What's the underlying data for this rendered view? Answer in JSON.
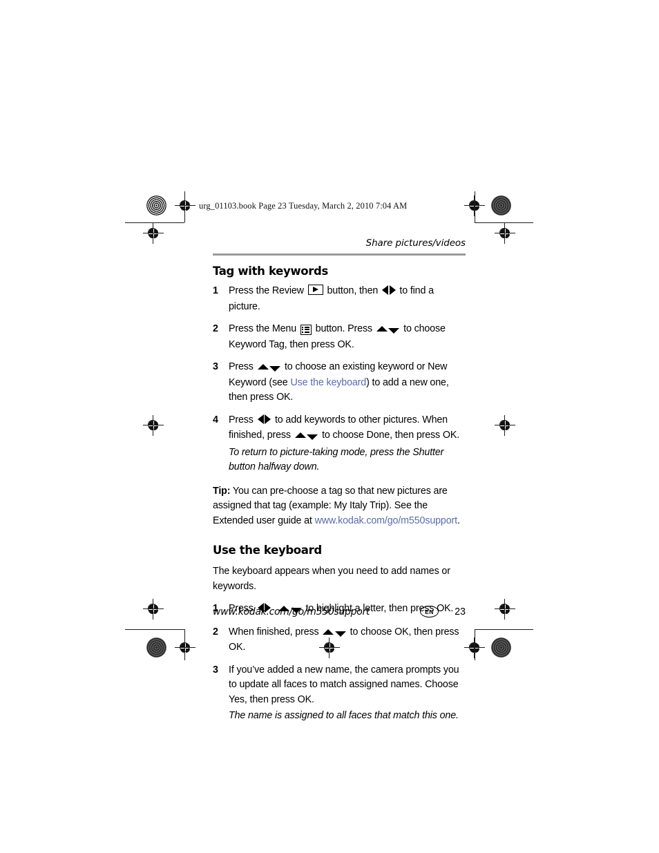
{
  "print_marks": {
    "filename_slug": "urg_01103.book  Page 23  Tuesday, March 2, 2010  7:04 AM"
  },
  "header": {
    "running_head": "Share pictures/videos"
  },
  "sections": [
    {
      "title": "Tag with keywords",
      "steps": [
        {
          "num": "1",
          "parts": [
            {
              "type": "text",
              "value": "Press the Review "
            },
            {
              "type": "icon",
              "value": "review-button-icon"
            },
            {
              "type": "text",
              "value": " button, then "
            },
            {
              "type": "icon",
              "value": "left-right-arrows-icon"
            },
            {
              "type": "text",
              "value": " to find a picture."
            }
          ]
        },
        {
          "num": "2",
          "parts": [
            {
              "type": "text",
              "value": "Press the Menu "
            },
            {
              "type": "icon",
              "value": "menu-button-icon"
            },
            {
              "type": "text",
              "value": " button. Press "
            },
            {
              "type": "icon",
              "value": "up-down-arrows-icon"
            },
            {
              "type": "text",
              "value": " to choose Keyword Tag, then press OK."
            }
          ]
        },
        {
          "num": "3",
          "parts": [
            {
              "type": "text",
              "value": "Press "
            },
            {
              "type": "icon",
              "value": "up-down-arrows-icon"
            },
            {
              "type": "text",
              "value": " to choose an existing keyword or New Keyword (see "
            },
            {
              "type": "link",
              "value": "Use the keyboard"
            },
            {
              "type": "text",
              "value": ") to add a new one, then press OK."
            }
          ]
        },
        {
          "num": "4",
          "parts": [
            {
              "type": "text",
              "value": "Press "
            },
            {
              "type": "icon",
              "value": "left-right-arrows-icon"
            },
            {
              "type": "text",
              "value": " to add keywords to other pictures. When finished, press "
            },
            {
              "type": "icon",
              "value": "up-down-arrows-icon"
            },
            {
              "type": "text",
              "value": " to choose Done, then press OK."
            }
          ]
        }
      ],
      "note": "To return to picture-taking mode, press the Shutter button halfway down.",
      "tip": {
        "label": "Tip:",
        "text_before": " You can pre-choose a tag so that new pictures are assigned that tag (example: My Italy Trip). See the Extended user guide at ",
        "link": "www.kodak.com/go/m550support",
        "text_after": "."
      }
    },
    {
      "title": "Use the keyboard",
      "intro": "The keyboard appears when you need to add names or keywords.",
      "steps": [
        {
          "num": "1",
          "parts": [
            {
              "type": "text",
              "value": "Press "
            },
            {
              "type": "icon",
              "value": "left-right-arrows-icon"
            },
            {
              "type": "gap",
              "value": ""
            },
            {
              "type": "icon",
              "value": "up-down-arrows-icon"
            },
            {
              "type": "text",
              "value": " to highlight a letter, then press OK."
            }
          ]
        },
        {
          "num": "2",
          "parts": [
            {
              "type": "text",
              "value": "When finished, press "
            },
            {
              "type": "icon",
              "value": "up-down-arrows-icon"
            },
            {
              "type": "text",
              "value": " to choose OK, then press OK."
            }
          ]
        },
        {
          "num": "3",
          "parts": [
            {
              "type": "text",
              "value": "If you’ve added a new name, the camera prompts you to update all faces to match assigned names. Choose Yes, then press OK."
            }
          ]
        }
      ],
      "note": "The name is assigned to all faces that match this one."
    }
  ],
  "footer": {
    "url": "www.kodak.com/go/m550support",
    "language_badge": "EN",
    "page_number": "23"
  },
  "colors": {
    "link": "#5a6cad",
    "rule": "#9a9a9a",
    "text": "#000000"
  }
}
